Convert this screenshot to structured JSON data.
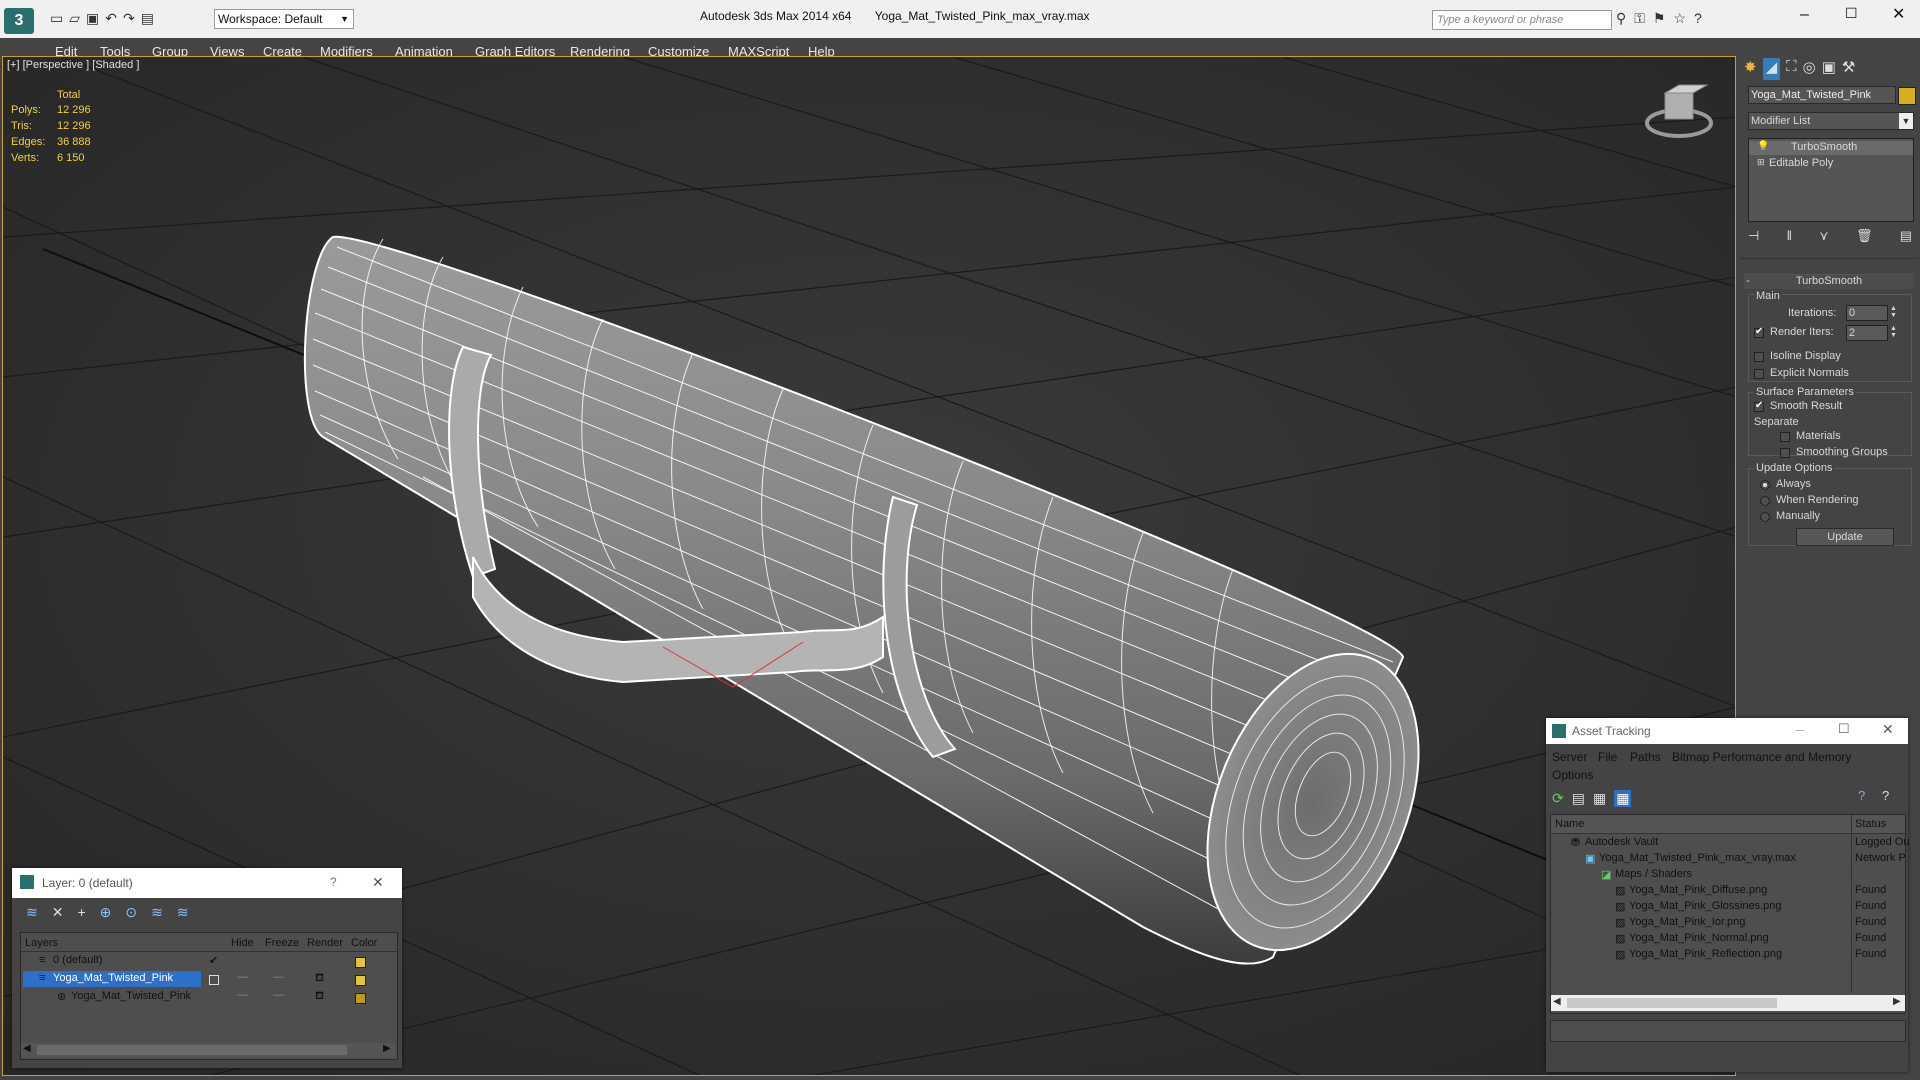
{
  "app": {
    "title": "Autodesk 3ds Max  2014 x64",
    "filename": "Yoga_Mat_Twisted_Pink_max_vray.max",
    "workspace": "Workspace: Default",
    "search_placeholder": "Type a keyword or phrase"
  },
  "menu": [
    "Edit",
    "Tools",
    "Group",
    "Views",
    "Create",
    "Modifiers",
    "Animation",
    "Graph Editors",
    "Rendering",
    "Customize",
    "MAXScript",
    "Help"
  ],
  "viewport": {
    "label": "[+] [Perspective ] [Shaded ]",
    "stats_header": "Total",
    "stats": [
      {
        "label": "Polys:",
        "value": "12 296"
      },
      {
        "label": "Tris:",
        "value": "12 296"
      },
      {
        "label": "Edges:",
        "value": "36 888"
      },
      {
        "label": "Verts:",
        "value": "6 150"
      }
    ]
  },
  "command_panel": {
    "object_name": "Yoga_Mat_Twisted_Pink",
    "modifier_list": "Modifier List",
    "stack": [
      "TurboSmooth",
      "Editable Poly"
    ],
    "rollout_title": "TurboSmooth",
    "main_label": "Main",
    "iterations_label": "Iterations:",
    "iterations_value": "0",
    "render_iters_label": "Render Iters:",
    "render_iters_value": "2",
    "isoline_label": "Isoline Display",
    "explicit_normals_label": "Explicit Normals",
    "surface_params_label": "Surface Parameters",
    "smooth_result_label": "Smooth Result",
    "separate_label": "Separate",
    "materials_label": "Materials",
    "smoothing_groups_label": "Smoothing Groups",
    "update_options_label": "Update Options",
    "always_label": "Always",
    "when_rendering_label": "When Rendering",
    "manually_label": "Manually",
    "update_button": "Update",
    "accent_color": "#d4b01c"
  },
  "layer_window": {
    "title": "Layer: 0 (default)",
    "help": "?",
    "columns": [
      "Layers",
      "Hide",
      "Freeze",
      "Render",
      "Color"
    ],
    "rows": [
      {
        "name": "0 (default)",
        "color": "#e6c23a"
      },
      {
        "name": "Yoga_Mat_Twisted_Pink",
        "color": "#e6c23a"
      },
      {
        "name": "Yoga_Mat_Twisted_Pink",
        "color": "#b89a1c"
      }
    ]
  },
  "asset_tracking": {
    "title": "Asset Tracking",
    "menu": [
      "Server",
      "File",
      "Paths",
      "Bitmap Performance and Memory"
    ],
    "menu2": "Options",
    "columns": [
      "Name",
      "Status"
    ],
    "rows": [
      {
        "name": "Autodesk Vault",
        "status": "Logged Ou"
      },
      {
        "name": "Yoga_Mat_Twisted_Pink_max_vray.max",
        "status": "Network P"
      },
      {
        "name": "Maps / Shaders",
        "status": ""
      },
      {
        "name": "Yoga_Mat_Pink_Diffuse.png",
        "status": "Found"
      },
      {
        "name": "Yoga_Mat_Pink_Glossines.png",
        "status": "Found"
      },
      {
        "name": "Yoga_Mat_Pink_Ior.png",
        "status": "Found"
      },
      {
        "name": "Yoga_Mat_Pink_Normal.png",
        "status": "Found"
      },
      {
        "name": "Yoga_Mat_Pink_Reflection.png",
        "status": "Found"
      }
    ]
  }
}
